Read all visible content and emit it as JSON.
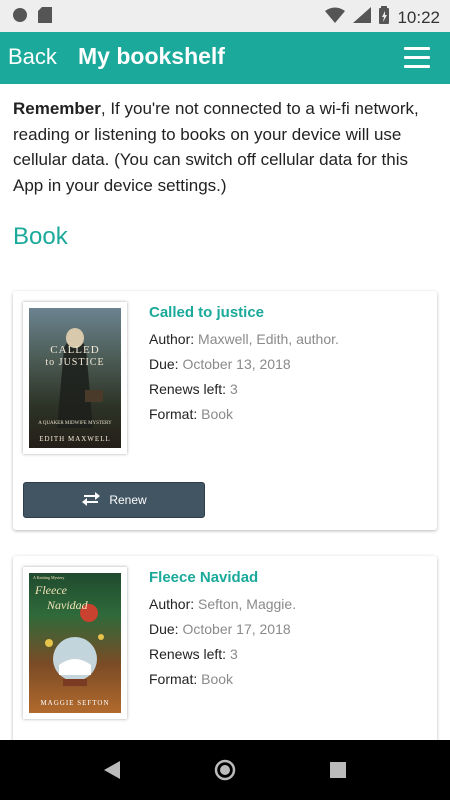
{
  "status_bar": {
    "time": "10:22"
  },
  "header": {
    "back_label": "Back",
    "title": "My bookshelf"
  },
  "notice": {
    "bold": "Remember",
    "text": ", If you're not connected to a wi-fi network, reading or listening to books on your device will use cellular data. (You can switch off cellular data for this App in your device settings.)"
  },
  "section_title": "Book",
  "labels": {
    "author": "Author:",
    "due": "Due:",
    "renews": "Renews left:",
    "format": "Format:"
  },
  "books": [
    {
      "title": "Called to justice",
      "author": "Maxwell, Edith, author.",
      "due": "October 13, 2018",
      "renews_left": "3",
      "format": "Book",
      "renew_label": "Renew",
      "cover": {
        "line1": "CALLED",
        "line2": "to JUSTICE",
        "author": "EDITH MAXWELL",
        "series": "A QUAKER MIDWIFE MYSTERY"
      }
    },
    {
      "title": "Fleece Navidad",
      "author": "Sefton, Maggie.",
      "due": "October 17, 2018",
      "renews_left": "3",
      "format": "Book",
      "cover": {
        "line1": "Fleece",
        "line2": "Navidad",
        "author": "MAGGIE SEFTON",
        "series": "A Knitting Mystery"
      }
    }
  ],
  "colors": {
    "accent": "#1aa99a",
    "button": "#425563"
  }
}
